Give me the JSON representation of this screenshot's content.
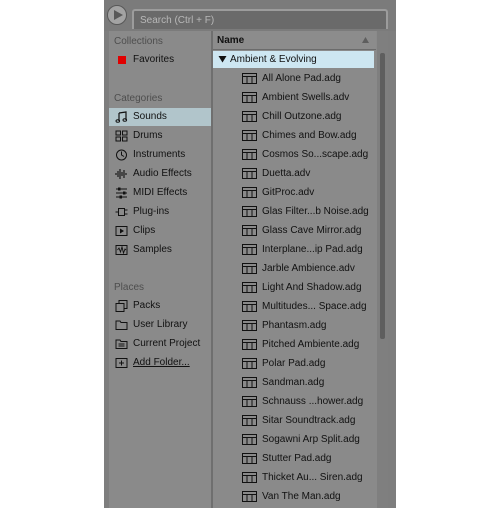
{
  "search": {
    "placeholder": "Search (Ctrl + F)"
  },
  "sidebar": {
    "collections_title": "Collections",
    "favorites": {
      "label": "Favorites",
      "color": "#e00000"
    },
    "categories_title": "Categories",
    "categories": [
      {
        "label": "Sounds",
        "icon": "music-note-icon",
        "selected": true
      },
      {
        "label": "Drums",
        "icon": "drum-pads-icon"
      },
      {
        "label": "Instruments",
        "icon": "clock-instrument-icon"
      },
      {
        "label": "Audio Effects",
        "icon": "waveform-icon"
      },
      {
        "label": "MIDI Effects",
        "icon": "midi-sliders-icon"
      },
      {
        "label": "Plug-ins",
        "icon": "plug-icon"
      },
      {
        "label": "Clips",
        "icon": "clip-icon"
      },
      {
        "label": "Samples",
        "icon": "sample-waveform-icon"
      }
    ],
    "places_title": "Places",
    "places": [
      {
        "label": "Packs",
        "icon": "packs-icon"
      },
      {
        "label": "User Library",
        "icon": "folder-icon"
      },
      {
        "label": "Current Project",
        "icon": "project-folder-icon"
      },
      {
        "label": "Add Folder...",
        "icon": "add-folder-icon"
      }
    ],
    "selected_color": "#b1c5cb"
  },
  "files": {
    "column_header": "Name",
    "folder_label": "Ambient & Evolving",
    "folder_highlight_color": "#cde6f1",
    "items": [
      "All Alone Pad.adg",
      "Ambient Swells.adv",
      "Chill Outzone.adg",
      "Chimes and Bow.adg",
      "Cosmos So...scape.adg",
      "Duetta.adv",
      "GitProc.adv",
      "Glas Filter...b Noise.adg",
      "Glass Cave Mirror.adg",
      "Interplane...ip Pad.adg",
      "Jarble Ambience.adv",
      "Light And Shadow.adg",
      "Multitudes... Space.adg",
      "Phantasm.adg",
      "Pitched Ambiente.adg",
      "Polar Pad.adg",
      "Sandman.adg",
      "Schnauss ...hower.adg",
      "Sitar Soundtrack.adg",
      "Sogawni Arp Split.adg",
      "Stutter Pad.adg",
      "Thicket Au... Siren.adg",
      "Van The Man.adg"
    ]
  }
}
